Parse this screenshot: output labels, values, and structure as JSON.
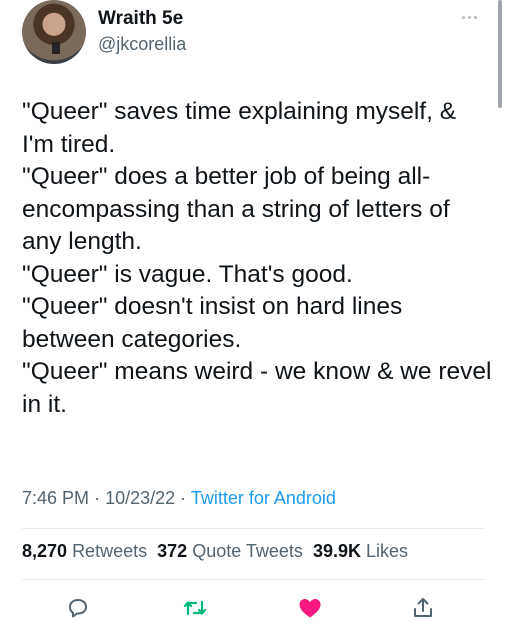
{
  "author": {
    "name": "Wraith 5e",
    "handle": "@jkcorellia"
  },
  "tweet": {
    "lines": [
      "\"Queer\" saves time explaining myself, & I'm tired.",
      "\"Queer\" does a better job of being all-encompassing than a string of letters of any length.",
      "\"Queer\" is vague. That's good.",
      "\"Queer\" doesn't insist on hard lines between categories.",
      "\"Queer\" means weird - we know & we revel in it."
    ]
  },
  "meta": {
    "time": "7:46 PM",
    "date": "10/23/22",
    "separator": "·",
    "source": "Twitter for Android"
  },
  "stats": {
    "retweets_count": "8,270",
    "retweets_label": "Retweets",
    "quotes_count": "372",
    "quotes_label": "Quote Tweets",
    "likes_count": "39.9K",
    "likes_label": "Likes"
  },
  "icons": {
    "reply": "reply-icon",
    "retweet": "retweet-icon",
    "like": "heart-icon",
    "share": "share-icon",
    "more": "more-icon"
  },
  "colors": {
    "link": "#1d9bf0",
    "retweet": "#00ba7c",
    "like": "#f91880",
    "secondary_text": "#536471"
  }
}
